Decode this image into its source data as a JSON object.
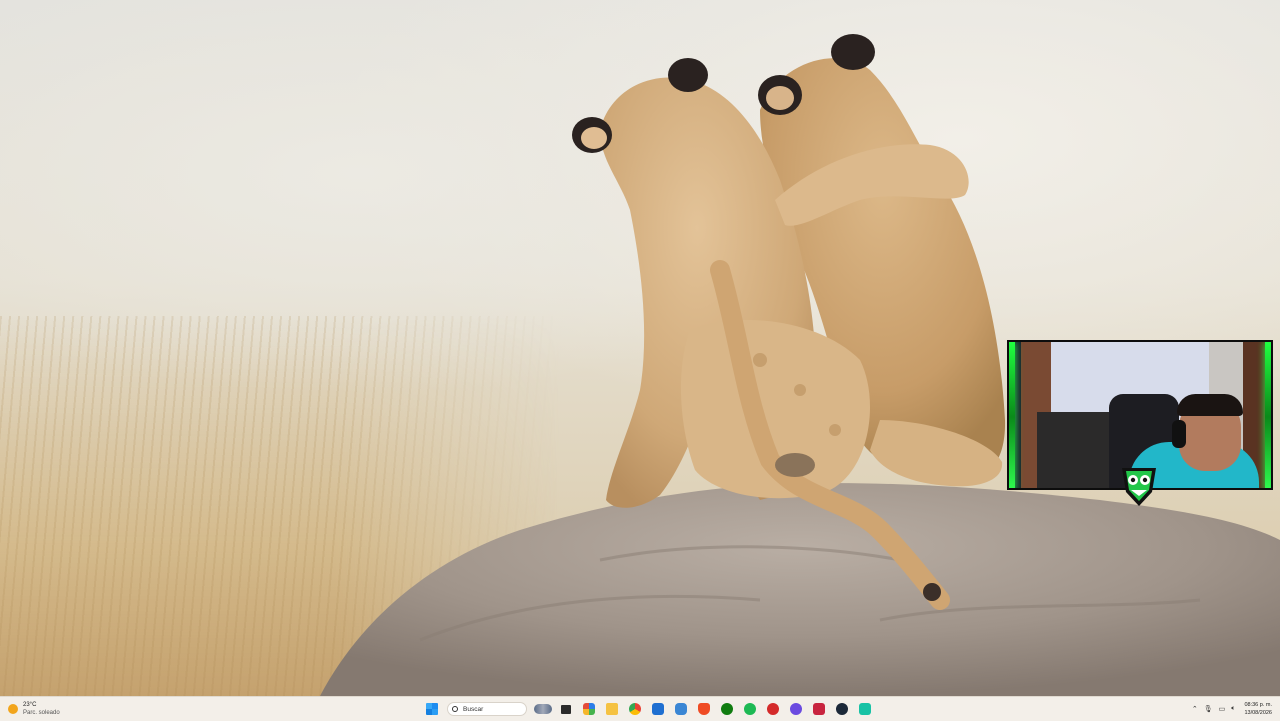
{
  "desktop": {
    "wallpaper": "two lion cubs on a termite mound"
  },
  "webcam": {
    "glow_color": "#2aff4a"
  },
  "taskbar": {
    "weather": {
      "temperature": "23°C",
      "condition": "Parc. soleado",
      "icon": "sun-icon"
    },
    "search": {
      "placeholder": "Buscar"
    },
    "apps": [
      {
        "name": "file-explorer-icon",
        "color": "#f5c242"
      },
      {
        "name": "chrome-icon",
        "color": "#e94235"
      },
      {
        "name": "store-icon",
        "color": "#1f6fd1"
      },
      {
        "name": "brave-icon",
        "color": "#ef4b23"
      },
      {
        "name": "xbox-icon",
        "color": "#107c10"
      },
      {
        "name": "spotify-icon",
        "color": "#1db954"
      },
      {
        "name": "steam-icon",
        "color": "#1b2838"
      }
    ],
    "clock": {
      "time": "08:36 p. m.",
      "date": "13/08/2026"
    }
  }
}
